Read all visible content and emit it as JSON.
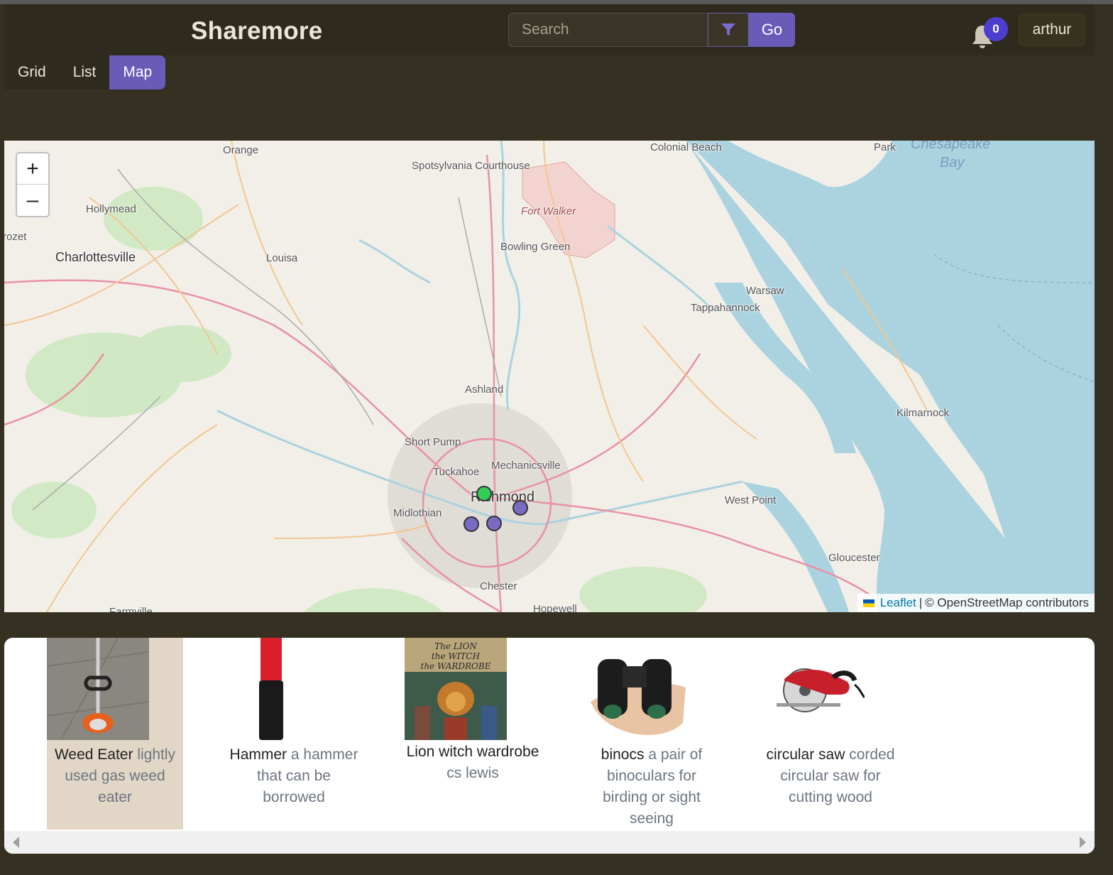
{
  "header": {
    "brand": "Sharemore",
    "search_placeholder": "Search",
    "go_label": "Go",
    "notification_count": "0",
    "username": "arthur"
  },
  "view_tabs": [
    {
      "label": "Grid",
      "active": false
    },
    {
      "label": "List",
      "active": false
    },
    {
      "label": "Map",
      "active": true
    }
  ],
  "map": {
    "zoom_in": "+",
    "zoom_out": "–",
    "places": [
      "Orange",
      "Spotsylvania Courthouse",
      "Colonial Beach",
      "Park",
      "Chesapeake",
      "Bay",
      "Hollymead",
      "Fort Walker",
      "rozet",
      "Charlottesville",
      "Louisa",
      "Bowling Green",
      "Warsaw",
      "Tappahannock",
      "Ashland",
      "Kilmarnock",
      "Short Pump",
      "Mechanicsville",
      "Tuckahoe",
      "Richmond",
      "Midlothian",
      "West Point",
      "Gloucester",
      "Chester",
      "Farmville",
      "Hopewell"
    ],
    "markers": [
      {
        "color": "#33cc55",
        "status": "current"
      },
      {
        "color": "#7a6bc0",
        "status": "item"
      },
      {
        "color": "#7a6bc0",
        "status": "item"
      },
      {
        "color": "#7a6bc0",
        "status": "item"
      }
    ],
    "attribution": {
      "leaflet": "Leaflet",
      "separator": "|",
      "osm": "© OpenStreetMap contributors"
    }
  },
  "items": [
    {
      "name": "Weed Eater",
      "description": "lightly used gas weed eater",
      "selected": true,
      "icon": "weed-eater-photo"
    },
    {
      "name": "Hammer",
      "description": "a hammer that can be borrowed",
      "selected": false,
      "icon": "hammer-photo"
    },
    {
      "name": "Lion witch wardrobe",
      "description": "cs lewis",
      "selected": false,
      "icon": "book-cover-photo"
    },
    {
      "name": "binocs",
      "description": "a pair of binoculars for birding or sight seeing",
      "selected": false,
      "icon": "binoculars-photo"
    },
    {
      "name": "circular saw",
      "description": "corded circular saw for cutting wood",
      "selected": false,
      "icon": "circular-saw-photo"
    }
  ],
  "colors": {
    "background": "#353022",
    "accent": "#6a5bb8",
    "badge": "#4b3fcf",
    "selected_card": "#e2d6c6"
  }
}
